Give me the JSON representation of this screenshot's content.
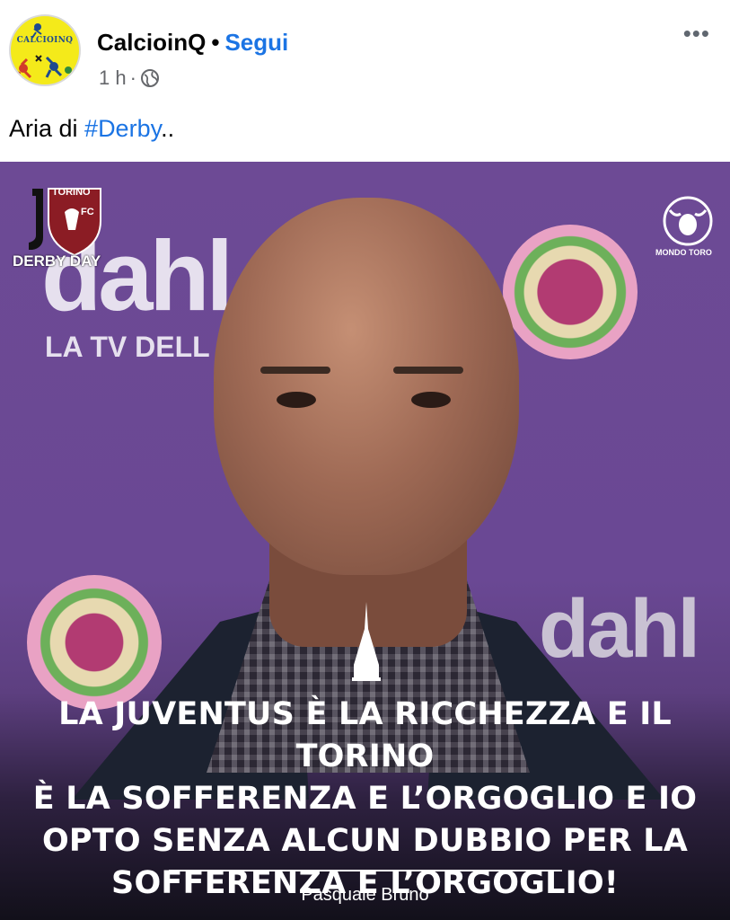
{
  "post": {
    "author": "CalcioinQ",
    "separator": "•",
    "follow_label": "Segui",
    "time": "1 h",
    "meta_sep": "·",
    "avatar_text": "CALCIOINQ",
    "caption_prefix": "Aria di ",
    "caption_tag": "#Derby",
    "caption_suffix": ".."
  },
  "image": {
    "badge_label": "DERBY DAY",
    "torino_text": "TORINO",
    "fc_text": "FC",
    "bg_word_top": "dahl",
    "bg_sub": "LA TV DELL",
    "bg_word_bottom": "dahl",
    "mondo_text": "MONDO TORO",
    "quote_lines": [
      "LA JUVENTUS È LA RICCHEZZA E IL TORINO",
      "È LA SOFFERENZA E L’ORGOGLIO E IO",
      "OPTO SENZA ALCUN DUBBIO PER LA",
      "SOFFERENZA E L’ORGOGLIO!"
    ],
    "signature": "Pasquale Bruno"
  },
  "icons": {
    "globe": "globe-icon",
    "more": "more-options-icon"
  }
}
